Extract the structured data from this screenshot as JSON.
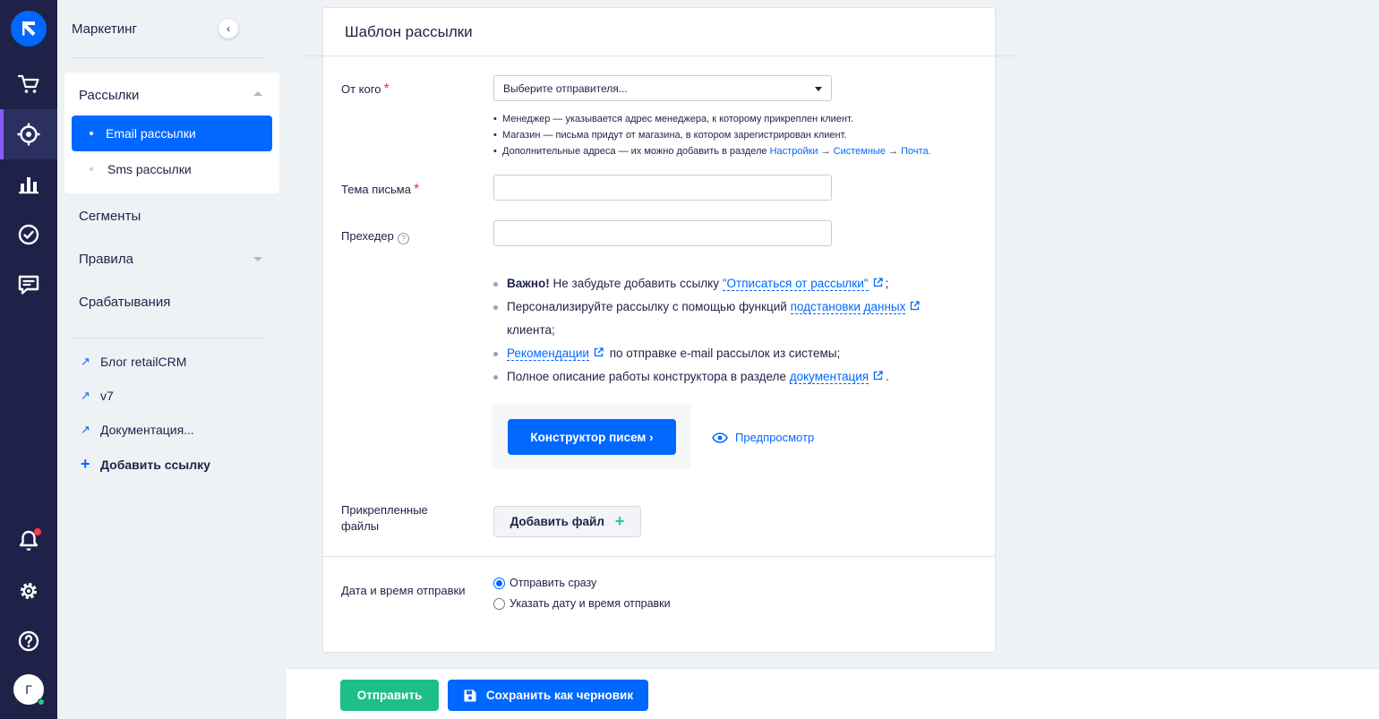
{
  "sidebar": {
    "title": "Маркетинг",
    "group": {
      "label": "Рассылки",
      "items": [
        {
          "label": "Email рассылки",
          "active": true
        },
        {
          "label": "Sms рассылки",
          "active": false
        }
      ]
    },
    "nav": [
      "Сегменты",
      "Правила",
      "Срабатывания"
    ],
    "links": [
      "Блог retailCRM",
      "v7",
      "Документация..."
    ],
    "add_link": "Добавить ссылку"
  },
  "rail": {
    "icons": [
      "logo-icon",
      "cart-icon",
      "target-icon",
      "chart-icon",
      "check-circle-icon",
      "chat-icon",
      "bell-icon",
      "gear-icon",
      "help-icon"
    ],
    "avatar": "Г"
  },
  "form": {
    "title": "Шаблон рассылки",
    "from_label": "От кого",
    "from_placeholder": "Выберите отправителя...",
    "hints": [
      "Менеджер — указывается адрес менеджера, к которому прикреплен клиент.",
      "Магазин — письма придут от магазина, в котором зарегистрирован клиент."
    ],
    "hint3_text": "Дополнительные адреса — их можно добавить в разделе",
    "hint3_links": [
      "Настройки",
      "Системные",
      "Почта."
    ],
    "hint3_arrow": "→",
    "subject_label": "Тема письма",
    "preheader_label": "Прехедер",
    "notes": {
      "n1_bold": "Важно!",
      "n1_text": "Не забудьте добавить ссылку",
      "n1_link": "\"Отписаться от рассылки\"",
      "n1_end": ";",
      "n2_text": "Персонализируйте рассылку с помощью функций",
      "n2_link": "подстановки данных",
      "n2_end": "клиента;",
      "n3_link": "Рекомендации",
      "n3_text": "по отправке e-mail рассылок из системы;",
      "n4_text": "Полное описание работы конструктора в разделе",
      "n4_link": "документация",
      "n4_end": "."
    },
    "builder_button": "Конструктор писем ›",
    "preview_link": "Предпросмотр",
    "attach_label": "Прикрепленные файлы",
    "add_file_button": "Добавить файл",
    "schedule_label": "Дата и время отправки",
    "schedule_options": [
      {
        "label": "Отправить сразу",
        "checked": true
      },
      {
        "label": "Указать дату и время отправки",
        "checked": false
      }
    ]
  },
  "footer": {
    "send_button": "Отправить",
    "draft_button": "Сохранить как черновик"
  }
}
